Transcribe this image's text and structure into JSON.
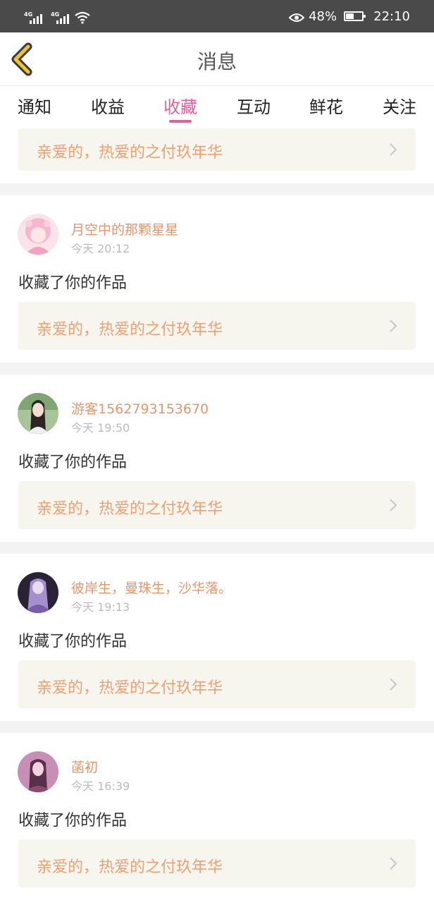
{
  "status_bar": {
    "sim1": "4G",
    "sim2": "4G",
    "battery_percent": "48%",
    "battery_level": 0.48,
    "time": "22:10",
    "icons": [
      "signal-icon",
      "wifi-icon",
      "eye-icon",
      "battery-icon"
    ]
  },
  "header": {
    "title": "消息",
    "back_icon": "back-chevron-icon",
    "accent_color": "#f2c12e"
  },
  "tabs": {
    "items": [
      "通知",
      "收益",
      "收藏",
      "互动",
      "鲜花",
      "关注"
    ],
    "active": "收藏",
    "active_color": "#e4609a"
  },
  "feed": {
    "partial_top": {
      "work_title": "亲爱的，热爱的之付玖年华"
    },
    "items": [
      {
        "user": "月空中的那颗星星",
        "time": "今天 20:12",
        "action": "收藏了你的作品",
        "work_title": "亲爱的，热爱的之付玖年华"
      },
      {
        "user": "游客1562793153670",
        "time": "今天 19:50",
        "action": "收藏了你的作品",
        "work_title": "亲爱的，热爱的之付玖年华"
      },
      {
        "user": "彼岸生，曼珠生，沙华落。",
        "time": "今天 19:13",
        "action": "收藏了你的作品",
        "work_title": "亲爱的，热爱的之付玖年华"
      },
      {
        "user": "菡初",
        "time": "今天 16:39",
        "action": "收藏了你的作品",
        "work_title": "亲爱的，热爱的之付玖年华"
      }
    ]
  }
}
